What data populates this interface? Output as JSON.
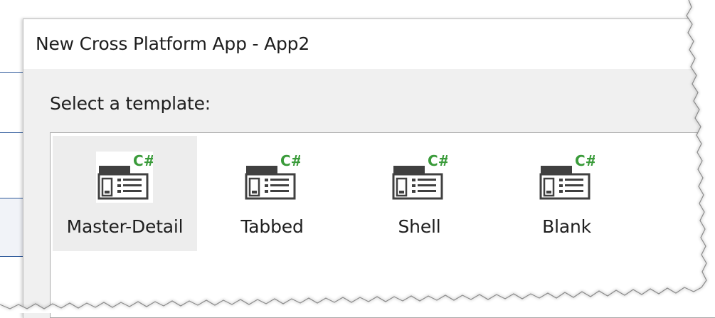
{
  "dialog": {
    "title": "New Cross Platform App - App2"
  },
  "content": {
    "select_label": "Select a template:"
  },
  "templates": [
    {
      "label": "Master-Detail",
      "icon": "csharp-template-icon",
      "selected": true
    },
    {
      "label": "Tabbed",
      "icon": "csharp-template-icon",
      "selected": false
    },
    {
      "label": "Shell",
      "icon": "csharp-template-icon",
      "selected": false
    },
    {
      "label": "Blank",
      "icon": "csharp-template-icon",
      "selected": false
    }
  ],
  "colors": {
    "icon_dark": "#404040",
    "icon_green": "#3a9b3a",
    "selected_bg": "#ededed",
    "content_bg": "#f0f0f0"
  }
}
